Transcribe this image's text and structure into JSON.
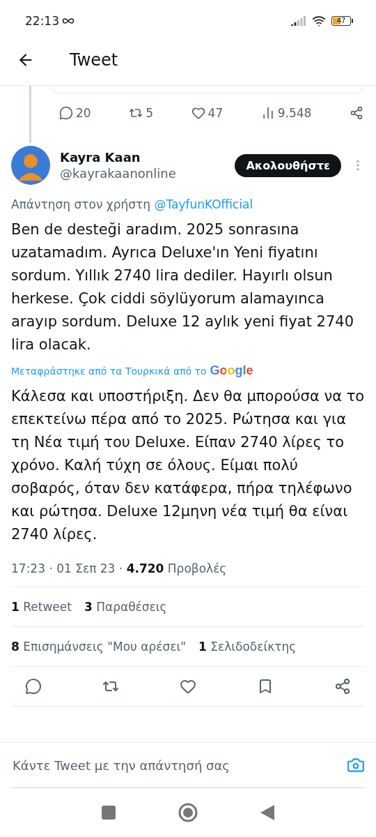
{
  "status_bar": {
    "time": "22:13",
    "battery": "47"
  },
  "header": {
    "title": "Tweet"
  },
  "previous_tweet": {
    "stats": [
      {
        "kind": "reply",
        "count": "20"
      },
      {
        "kind": "retweet",
        "count": "5"
      },
      {
        "kind": "like",
        "count": "47"
      },
      {
        "kind": "views",
        "count": "9.548"
      },
      {
        "kind": "share"
      }
    ]
  },
  "tweet": {
    "author": {
      "name": "Kayra Kaan",
      "handle": "@kayrakaanonline"
    },
    "follow_button": "Ακολουθήστε",
    "reply_to": {
      "prefix": "Απάντηση στον χρήστη",
      "user": "@TayfunKOfficial"
    },
    "text": "Ben de desteği aradım. 2025 sonrasına uzatamadım. Ayrıca Deluxe'ın Yeni fiyatını sordum. Yıllık 2740 lira dediler. Hayırlı olsun herkese. Çok ciddi söylüyorum alamayınca arayıp sordum. Deluxe 12 aylık yeni fiyat 2740 lira olacak.",
    "translation_note": {
      "label": "Μεταφράστηκε από τα Τουρκικά από το",
      "provider": "Google"
    },
    "translation": "Κάλεσα και υποστήριξη. Δεν θα μπορούσα να το επεκτείνω πέρα από το 2025. Ρώτησα και για τη Νέα τιμή του Deluxe. Είπαν 2740 λίρες το χρόνο. Καλή τύχη σε όλους. Είμαι πολύ σοβαρός, όταν δεν κατάφερα, πήρα τηλέφωνο και ρώτησα. Deluxe 12μηνη νέα τιμή θα είναι 2740 λίρες.",
    "meta": "17:23 · 01 Σεπ 23 · **4.720** Προβολές",
    "counts": [
      [
        "**1** Retweet",
        "**3** Παραθέσεις"
      ],
      [
        "**8** Επισημάνσεις \"Μου αρέσει\"",
        "**1** Σελιδοδείκτης"
      ]
    ],
    "actions": [
      {
        "kind": "reply"
      },
      {
        "kind": "retweet"
      },
      {
        "kind": "like"
      },
      {
        "kind": "bookmark"
      },
      {
        "kind": "share"
      }
    ]
  },
  "reply_bar": {
    "placeholder": "Κάντε Tweet με την απάντησή σας"
  }
}
